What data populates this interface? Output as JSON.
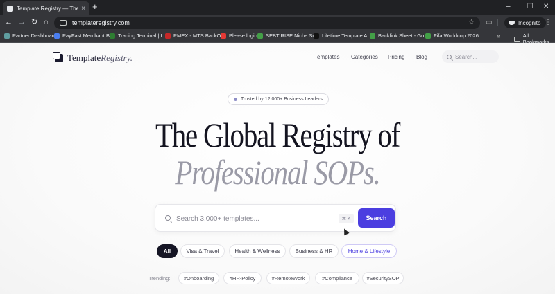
{
  "browser": {
    "tab_title": "Template Registry — The Glob",
    "tab_close": "×",
    "new_tab": "+",
    "window": {
      "minimize": "–",
      "restore": "❐",
      "close": "✕"
    },
    "nav": {
      "back": "←",
      "forward": "→",
      "reload": "↻",
      "home": "⌂"
    },
    "url": "templateregistry.com",
    "star": "☆",
    "incognito_label": "Incognito",
    "menu": "⋮",
    "bookmarks": [
      {
        "label": "Partner Dashboard",
        "icon_color": "#5f9ea0"
      },
      {
        "label": "PayFast Merchant B...",
        "icon_color": "#4a7ef0"
      },
      {
        "label": "Trading Terminal | L...",
        "icon_color": "#2e7d32"
      },
      {
        "label": "PMEX - MTS BackOf...",
        "icon_color": "#c62828"
      },
      {
        "label": "Please login",
        "icon_color": "#e53935"
      },
      {
        "label": "SEBT RISE Niche Su...",
        "icon_color": "#43a047"
      },
      {
        "label": "Lifetime Template A...",
        "icon_color": "#111111"
      },
      {
        "label": "Backlink Sheet - Go...",
        "icon_color": "#43a047"
      },
      {
        "label": "Fifa Worldcup 2026...",
        "icon_color": "#43a047"
      }
    ],
    "bookmarks_more": "»",
    "all_bookmarks": "All Bookmarks"
  },
  "header": {
    "logo_text_a": "Template",
    "logo_text_b": "Registry.",
    "nav_items": [
      "Templates",
      "Categories",
      "Pricing",
      "Blog"
    ],
    "search_placeholder": "Search..."
  },
  "hero": {
    "badge": "Trusted by 12,000+ Business Leaders",
    "headline_line1": "The Global Registry of",
    "headline_line2": "Professional SOPs.",
    "search_placeholder": "Search 3,000+ templates...",
    "shortcut": "⌘ K",
    "search_button": "Search"
  },
  "categories": [
    "All",
    "Visa & Travel",
    "Health & Wellness",
    "Business & HR",
    "Home & Lifestyle"
  ],
  "trending": {
    "label": "Trending:",
    "tags": [
      "#Onboarding",
      "#HR-Policy",
      "#RemoteWork",
      "#Compliance",
      "#SecuritySOP"
    ]
  },
  "colors": {
    "accent": "#4b3ee0",
    "dark": "#161625",
    "muted_headline": "#9a9aa6"
  }
}
